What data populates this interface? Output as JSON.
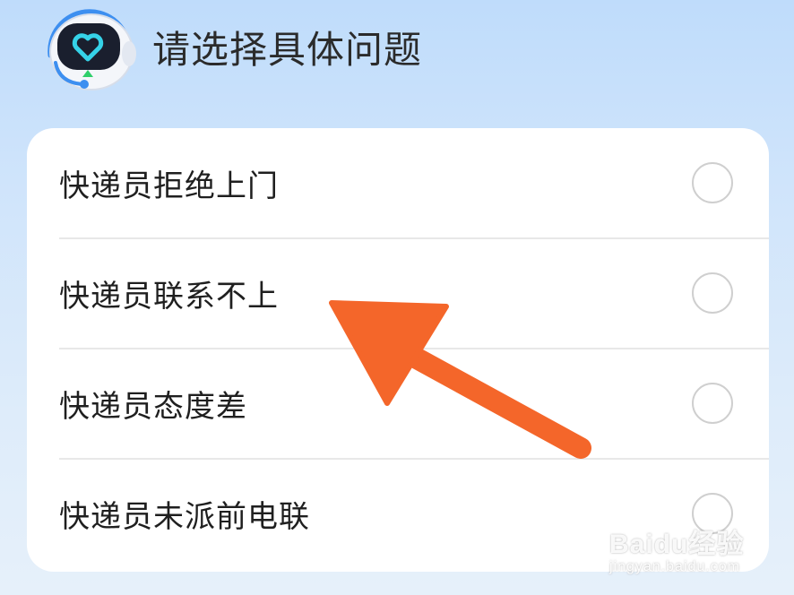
{
  "header": {
    "title": "请选择具体问题",
    "avatar_icon": "robot-assistant-heart-icon"
  },
  "options": [
    {
      "label": "快递员拒绝上门",
      "selected": false
    },
    {
      "label": "快递员联系不上",
      "selected": false
    },
    {
      "label": "快递员态度差",
      "selected": false
    },
    {
      "label": "快递员未派前电联",
      "selected": false
    }
  ],
  "annotation": {
    "icon": "orange-arrow-icon",
    "color": "#f4662a"
  },
  "watermark": {
    "brand": "Baidu经验",
    "url": "jingyan.baidu.com"
  }
}
